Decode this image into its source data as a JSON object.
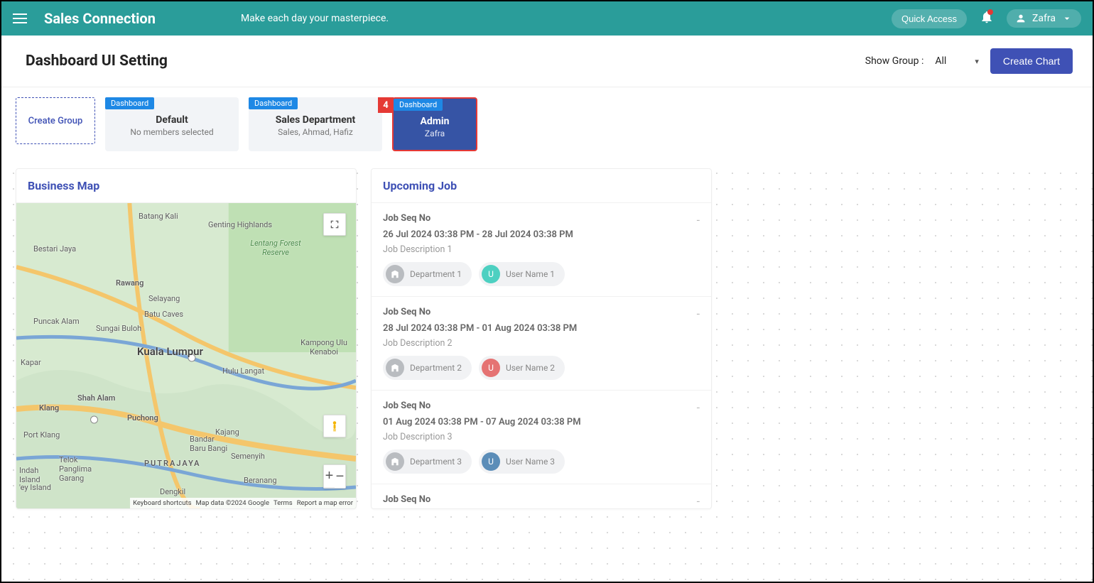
{
  "topbar": {
    "brand": "Sales Connection",
    "tagline": "Make each day your masterpiece.",
    "quick_access": "Quick Access",
    "user_name": "Zafra"
  },
  "header": {
    "title": "Dashboard UI Setting",
    "show_group_label": "Show Group :",
    "show_group_value": "All",
    "create_chart": "Create Chart"
  },
  "groups": {
    "create_label": "Create Group",
    "badge_text": "Dashboard",
    "step_number": "4",
    "items": [
      {
        "title": "Default",
        "sub": "No members selected",
        "active": false
      },
      {
        "title": "Sales Department",
        "sub": "Sales, Ahmad, Hafiz",
        "active": false
      },
      {
        "title": "Admin",
        "sub": "Zafra",
        "active": true
      }
    ]
  },
  "panels": {
    "map_title": "Business Map",
    "jobs_title": "Upcoming Job"
  },
  "map": {
    "attrib_shortcuts": "Keyboard shortcuts",
    "attrib_data": "Map data ©2024 Google",
    "attrib_terms": "Terms",
    "attrib_report": "Report a map error",
    "labels": {
      "kl": "Kuala Lumpur",
      "shah_alam": "Shah Alam",
      "klang": "Klang",
      "port_klang": "Port Klang",
      "puchong": "Puchong",
      "putrajaya": "PUTRAJAYA",
      "rawang": "Rawang",
      "batu_caves": "Batu Caves",
      "selayang": "Selayang",
      "sungai_buloh": "Sungai Buloh",
      "batang_kali": "Batang Kali",
      "genting": "Genting Highlands",
      "lentang": "Lentang Forest Reserve",
      "kampong": "Kampong Ulu Kenaboi",
      "hulu_langat": "Hulu Langat",
      "semenyih": "Semenyih",
      "kajang": "Kajang",
      "bandar": "Bandar Baru Bangi",
      "beranang": "Beranang",
      "dengkil": "Dengkil",
      "telok": "Telok Panglima Garang",
      "bestari": "Bestari Jaya",
      "puncak": "Puncak Alam",
      "kapar": "Kapar",
      "indah": "Indah Island",
      "ey_island": "'ey Island"
    }
  },
  "jobs": [
    {
      "seq": "Job Seq No",
      "time": "26 Jul 2024 03:38 PM - 28 Jul 2024 03:38 PM",
      "desc": "Job Description 1",
      "dept": "Department 1",
      "user_initial": "U",
      "user": "User Name 1",
      "user_color": "teal",
      "menu": "-"
    },
    {
      "seq": "Job Seq No",
      "time": "28 Jul 2024 03:38 PM - 01 Aug 2024 03:38 PM",
      "desc": "Job Description 2",
      "dept": "Department 2",
      "user_initial": "U",
      "user": "User Name 2",
      "user_color": "red",
      "menu": "-"
    },
    {
      "seq": "Job Seq No",
      "time": "01 Aug 2024 03:38 PM - 07 Aug 2024 03:38 PM",
      "desc": "Job Description 3",
      "dept": "Department 3",
      "user_initial": "U",
      "user": "User Name 3",
      "user_color": "blue",
      "menu": "-"
    },
    {
      "seq": "Job Seq No",
      "time": "",
      "desc": "",
      "dept": "",
      "user_initial": "",
      "user": "",
      "user_color": "",
      "menu": "-"
    }
  ]
}
